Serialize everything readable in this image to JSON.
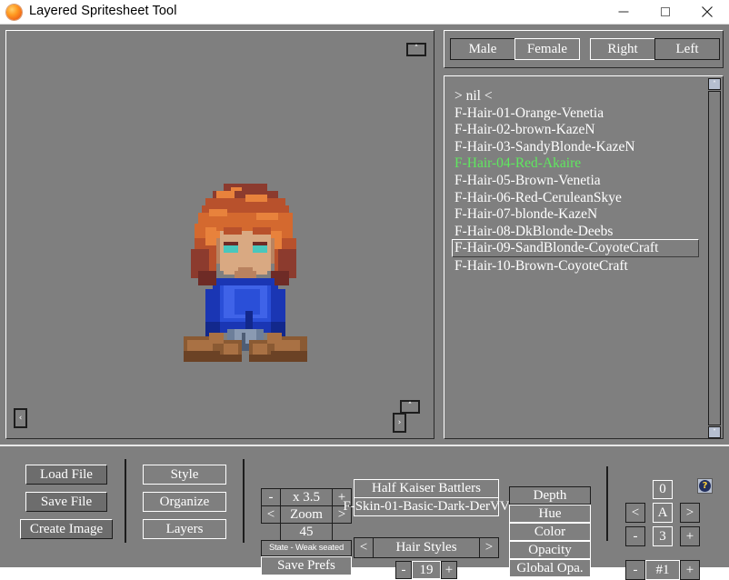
{
  "window": {
    "title": "Layered Spritesheet Tool",
    "icon": "orange-sphere-icon",
    "minimize_label": "—",
    "maximize_label": "□",
    "close_label": "×"
  },
  "canvas": {
    "nav_up_top_right": "˄",
    "nav_left_bottom_left": "‹",
    "nav_up_bottom_right": "˄",
    "nav_right_bottom_right": "›",
    "background_color": "#7f7f7f",
    "sprite_description": "seated female pixel-art character, red hair, blue shirt, brown boots"
  },
  "toggles": {
    "gender": [
      {
        "label": "Male",
        "selected": false
      },
      {
        "label": "Female",
        "selected": true
      }
    ],
    "facing": [
      {
        "label": "Right",
        "selected": true
      },
      {
        "label": "Left",
        "selected": false
      }
    ]
  },
  "list": {
    "items": [
      {
        "label": "> nil <",
        "state": "normal"
      },
      {
        "label": "F-Hair-01-Orange-Venetia",
        "state": "normal"
      },
      {
        "label": "F-Hair-02-brown-KazeN",
        "state": "normal"
      },
      {
        "label": "F-Hair-03-SandyBlonde-KazeN",
        "state": "normal"
      },
      {
        "label": "F-Hair-04-Red-Akaire",
        "state": "active"
      },
      {
        "label": "F-Hair-05-Brown-Venetia",
        "state": "normal"
      },
      {
        "label": "F-Hair-06-Red-CeruleanSkye",
        "state": "normal"
      },
      {
        "label": "F-Hair-07-blonde-KazeN",
        "state": "normal"
      },
      {
        "label": "F-Hair-08-DkBlonde-Deebs",
        "state": "normal"
      },
      {
        "label": "F-Hair-09-SandBlonde-CoyoteCraft",
        "state": "boxed"
      },
      {
        "label": "F-Hair-10-Brown-CoyoteCraft",
        "state": "normal"
      }
    ],
    "active_color": "#5fe85f",
    "text_color": "#ffffff",
    "scrollbar": {
      "up_arrow": "˄",
      "down_arrow": "˅"
    }
  },
  "toolbar": {
    "file_group": {
      "load_label": "Load File",
      "save_label": "Save File",
      "create_label": "Create Image"
    },
    "edit_group": {
      "style_label": "Style",
      "organize_label": "Organize",
      "layers_label": "Layers"
    },
    "zoom_group": {
      "minus_label": "-",
      "value_label": "x 3.5",
      "plus_label": "+",
      "prev_label": "<",
      "zoom_label": "Zoom",
      "next_label": ">",
      "frame_value": "45",
      "state_label": "State - Weak seated",
      "save_prefs_label": "Save Prefs"
    },
    "asset_group": {
      "set_label": "Half Kaiser Battlers",
      "skin_label": "F-Skin-01-Basic-Dark-DerVV",
      "prev_label": "<",
      "category_label": "Hair Styles",
      "next_label": ">",
      "minus_label": "-",
      "index_value": "19",
      "plus_label": "+"
    },
    "property_group": [
      {
        "label": "Depth"
      },
      {
        "label": "Hue"
      },
      {
        "label": "Color"
      },
      {
        "label": "Opacity"
      },
      {
        "label": "Global Opa."
      }
    ],
    "palette_group": {
      "top_value": "0",
      "prev_label": "<",
      "letter_value": "A",
      "next_label": ">",
      "minus_label": "-",
      "number_value": "3",
      "plus_label": "+",
      "minus2_label": "-",
      "id_value": "#1",
      "plus2_label": "+"
    },
    "help_label": "?"
  }
}
